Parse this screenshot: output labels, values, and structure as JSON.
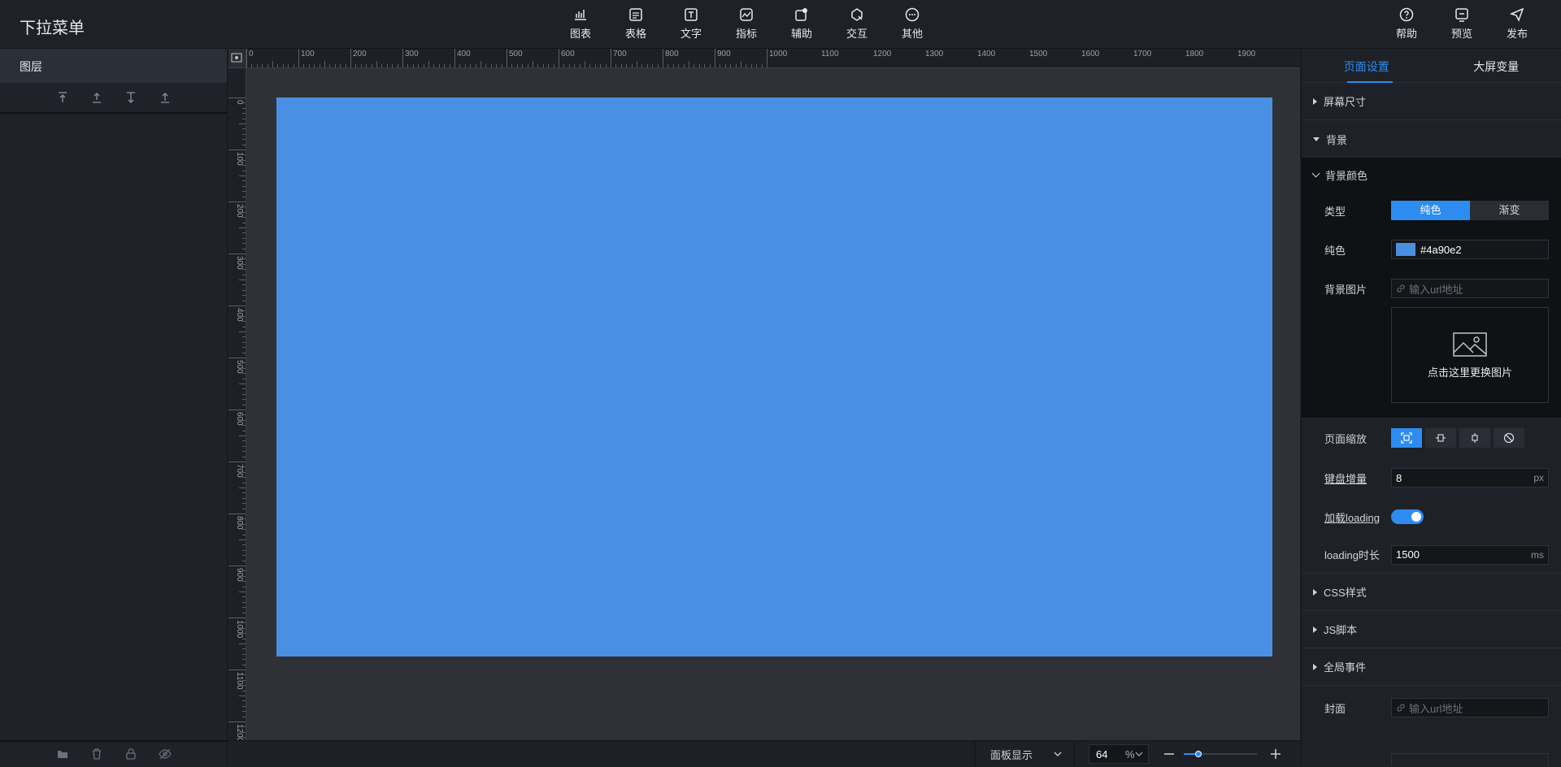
{
  "app": {
    "title": "下拉菜单"
  },
  "toolbar": {
    "tools": [
      {
        "label": "图表",
        "icon": "bar-chart-icon"
      },
      {
        "label": "表格",
        "icon": "table-icon"
      },
      {
        "label": "文字",
        "icon": "text-icon"
      },
      {
        "label": "指标",
        "icon": "indicator-icon"
      },
      {
        "label": "辅助",
        "icon": "assist-icon"
      },
      {
        "label": "交互",
        "icon": "interaction-icon"
      },
      {
        "label": "其他",
        "icon": "more-icon"
      }
    ],
    "right": [
      {
        "label": "帮助",
        "icon": "help-icon"
      },
      {
        "label": "预览",
        "icon": "preview-icon"
      },
      {
        "label": "发布",
        "icon": "publish-icon"
      }
    ]
  },
  "layers": {
    "title": "图层"
  },
  "ruler": {
    "h_labels": [
      "0",
      "100",
      "200",
      "300",
      "400",
      "500",
      "600",
      "700",
      "800",
      "900",
      "1000",
      "1100",
      "1200",
      "1300",
      "1400",
      "1500",
      "1600",
      "1700",
      "1800",
      "1900"
    ],
    "v_labels": [
      "0",
      "100",
      "200",
      "300",
      "400",
      "500",
      "600",
      "700",
      "800",
      "900",
      "1000",
      "1100",
      "1200"
    ]
  },
  "canvas": {
    "background": "#4a90e2"
  },
  "status": {
    "panel_display": "面板显示",
    "zoom": "64",
    "zoom_unit": "%",
    "zoom_fraction": 0.2
  },
  "right_panel": {
    "tabs": [
      "页面设置",
      "大屏变量"
    ],
    "sections": {
      "screen_size": "屏幕尺寸",
      "background": "背景",
      "bg_color": "背景颜色",
      "type_label": "类型",
      "type_options": [
        "纯色",
        "渐变"
      ],
      "solid_label": "纯色",
      "solid_value": "#4a90e2",
      "bg_image_label": "背景图片",
      "url_placeholder": "输入url地址",
      "replace_image": "点击这里更换图片",
      "page_scale": "页面缩放",
      "keyboard_step": "键盘增量",
      "keyboard_step_value": "8",
      "keyboard_step_unit": "px",
      "loading_label": "加载loading",
      "loading_duration": "loading时长",
      "loading_duration_value": "1500",
      "loading_duration_unit": "ms",
      "css": "CSS样式",
      "js": "JS脚本",
      "global_events": "全局事件",
      "cover": "封面",
      "cover_placeholder": "输入url地址"
    }
  },
  "colors": {
    "accent": "#2d8cf0",
    "canvas_bg": "#4a90e2"
  }
}
